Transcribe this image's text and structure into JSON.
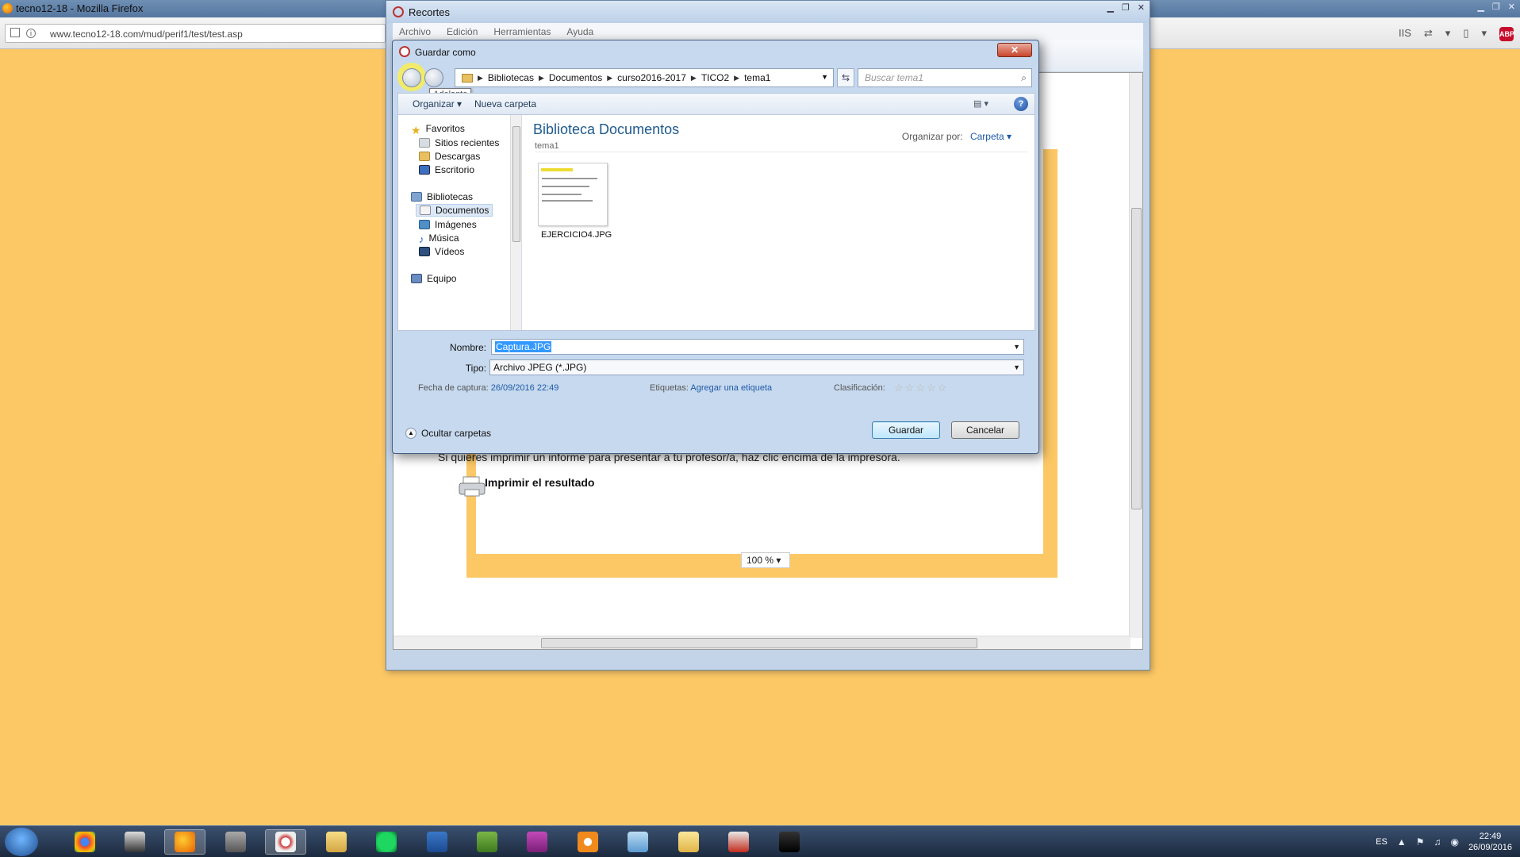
{
  "firefox": {
    "title": "tecno12-18 - Mozilla Firefox",
    "url": "www.tecno12-18.com/mud/perif1/test/test.asp",
    "tools": [
      "IIS",
      "⇄",
      "▾",
      "▯",
      "▾"
    ],
    "abp_label": "ABP"
  },
  "recortes": {
    "title": "Recortes",
    "menu": [
      "Archivo",
      "Edición",
      "Herramientas",
      "Ayuda"
    ],
    "captured_page": {
      "print_text": "Si quieres imprimir un informe para presentar a tu profesor/a, haz clic encima de la impresora.",
      "print_button": "Imprimir el resultado",
      "zoom": "100 %"
    }
  },
  "dialog": {
    "title": "Guardar como",
    "close_label": "✕",
    "tooltip": "Adelante",
    "breadcrumb": [
      "Bibliotecas",
      "Documentos",
      "curso2016-2017",
      "TICO2",
      "tema1"
    ],
    "search_placeholder": "Buscar tema1",
    "toolbar": {
      "organize": "Organizar ▾",
      "new_folder": "Nueva carpeta",
      "help": "?"
    },
    "nav": {
      "favorites_header": "Favoritos",
      "favorites": [
        "Sitios recientes",
        "Descargas",
        "Escritorio"
      ],
      "libraries_header": "Bibliotecas",
      "libraries": [
        "Documentos",
        "Imágenes",
        "Música",
        "Vídeos"
      ],
      "computer_header": "Equipo"
    },
    "main": {
      "library_title": "Biblioteca Documentos",
      "library_subtitle": "tema1",
      "arrange_label": "Organizar por:",
      "arrange_value": "Carpeta ▾",
      "files": [
        {
          "name": "EJERCICIO4.JPG"
        }
      ]
    },
    "fields": {
      "name_label": "Nombre:",
      "name_value": "Captura.JPG",
      "type_label": "Tipo:",
      "type_value": "Archivo JPEG (*.JPG)",
      "date_label": "Fecha de captura:",
      "date_value": "26/09/2016 22:49",
      "tags_label": "Etiquetas:",
      "tags_value": "Agregar una etiqueta",
      "rating_label": "Clasificación:",
      "rating_value": 0,
      "rating_max": 5
    },
    "hide_folders": "Ocultar carpetas",
    "save_button": "Guardar",
    "cancel_button": "Cancelar"
  },
  "taskbar": {
    "apps": [
      "chrome",
      "inkscape",
      "firefox",
      "system-tool",
      "snipping-tool",
      "file-explorer",
      "spotify",
      "word",
      "project",
      "onenote-app",
      "settings-gear",
      "notepad",
      "folder",
      "acrobat",
      "terminal"
    ],
    "language": "ES",
    "time": "22:49",
    "date": "26/09/2016"
  },
  "colors": {
    "page_bg": "#fcc866",
    "dialog_accent": "#1e5a8c",
    "selection": "#3399ff"
  }
}
